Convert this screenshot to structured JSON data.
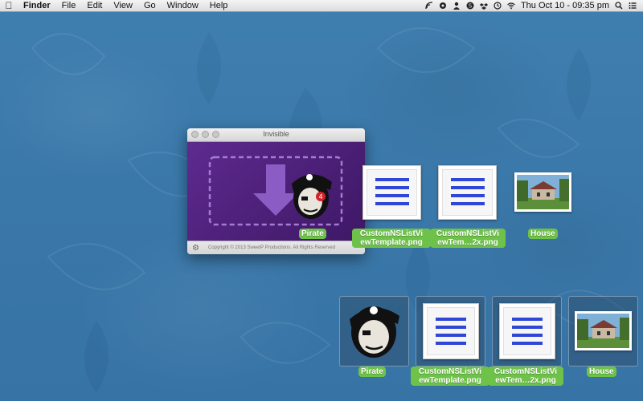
{
  "menubar": {
    "app_name": "Finder",
    "menus": [
      "File",
      "Edit",
      "View",
      "Go",
      "Window",
      "Help"
    ],
    "clock": "Thu Oct 10 - 09:35 pm"
  },
  "window": {
    "title": "Invisible",
    "footer": "Copyright © 2013 SweetP Productions. All Rights Reserved",
    "badge_count": "4"
  },
  "icons_row1": [
    {
      "label": "Pirate"
    },
    {
      "label_line1": "CustomNSListVi",
      "label_line2": "ewTemplate.png"
    },
    {
      "label_line1": "CustomNSListVi",
      "label_line2": "ewTem…2x.png"
    },
    {
      "label": "House"
    }
  ],
  "icons_row2": [
    {
      "label": "Pirate"
    },
    {
      "label_line1": "CustomNSListVi",
      "label_line2": "ewTemplate.png"
    },
    {
      "label_line1": "CustomNSListVi",
      "label_line2": "ewTem…2x.png"
    },
    {
      "label": "House"
    }
  ],
  "colors": {
    "label_green": "#6ec24a",
    "window_purple": "#5e2a8f",
    "list_blue": "#2f46d8"
  }
}
